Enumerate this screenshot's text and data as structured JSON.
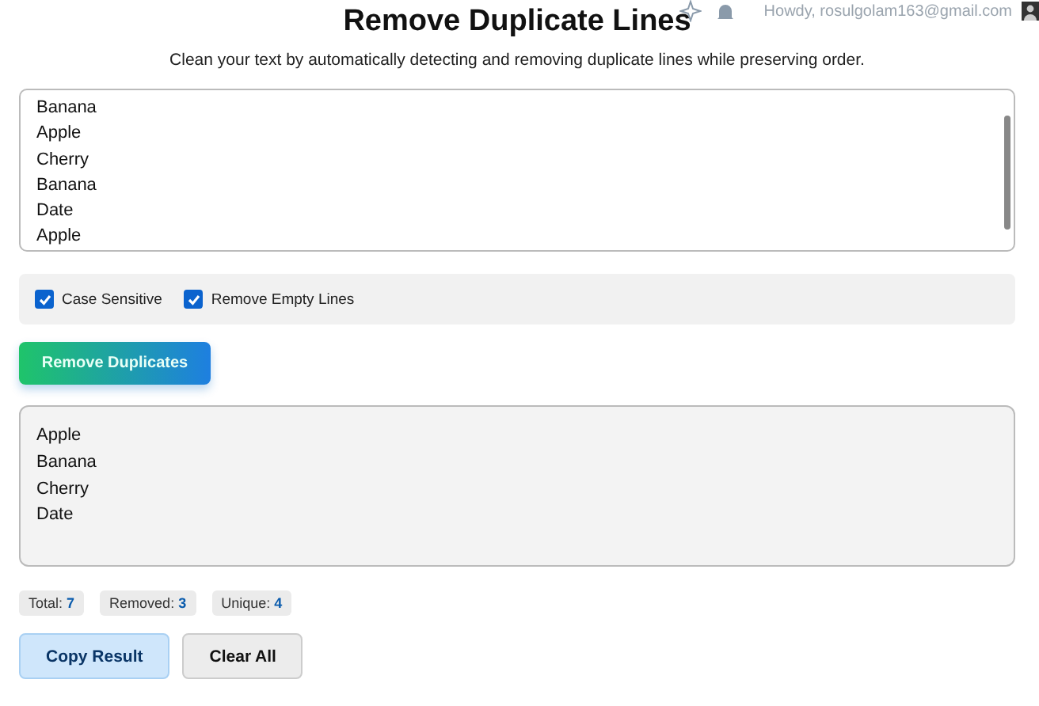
{
  "admin_bar": {
    "greeting": "Howdy, rosulgolam163@gmail.com"
  },
  "title": "Remove Duplicate Lines",
  "subtitle": "Clean your text by automatically detecting and removing duplicate lines while preserving order.",
  "input": {
    "lines": [
      "Banana",
      "Apple",
      "Cherry",
      "Banana",
      "Date",
      "Apple"
    ]
  },
  "options": [
    {
      "label": "Case Sensitive",
      "checked": true
    },
    {
      "label": "Remove Empty Lines",
      "checked": true
    }
  ],
  "action_button": "Remove Duplicates",
  "output": {
    "lines": [
      "Apple",
      "Banana",
      "Cherry",
      "Date"
    ]
  },
  "stats": [
    {
      "label": "Total:",
      "value": "7"
    },
    {
      "label": "Removed:",
      "value": "3"
    },
    {
      "label": "Unique:",
      "value": "4"
    }
  ],
  "buttons": [
    {
      "label": "Copy Result",
      "kind": "primary"
    },
    {
      "label": "Clear All",
      "kind": "secondary"
    }
  ]
}
